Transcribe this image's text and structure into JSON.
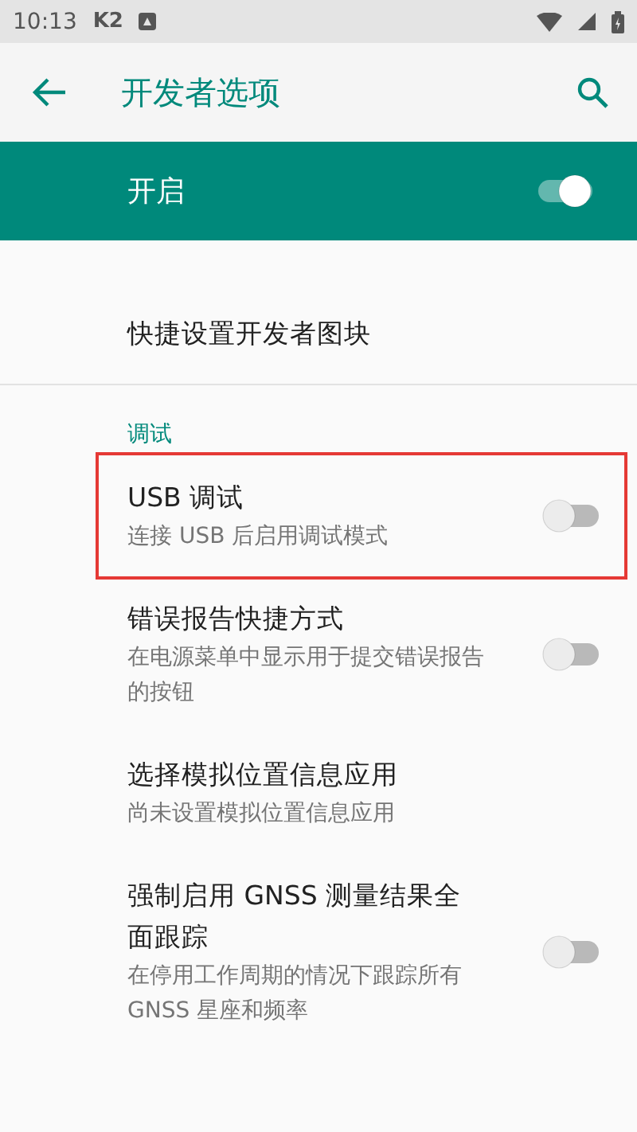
{
  "status_bar": {
    "time": "10:13",
    "carrier": "K2"
  },
  "app_bar": {
    "title": "开发者选项"
  },
  "master_switch": {
    "label": "开启",
    "on": true
  },
  "items": [
    {
      "kind": "plain",
      "title": "快捷设置开发者图块",
      "divider_after": true
    },
    {
      "kind": "category",
      "title": "调试"
    },
    {
      "kind": "switch",
      "title": "USB 调试",
      "summary": "连接 USB 后启用调试模式",
      "on": false,
      "highlighted": true
    },
    {
      "kind": "switch",
      "title": "错误报告快捷方式",
      "summary": "在电源菜单中显示用于提交错误报告的按钮",
      "on": false,
      "highlighted": false
    },
    {
      "kind": "plain",
      "title": "选择模拟位置信息应用",
      "summary": "尚未设置模拟位置信息应用"
    },
    {
      "kind": "switch",
      "title": "强制启用 GNSS 测量结果全面跟踪",
      "summary": "在停用工作周期的情况下跟踪所有 GNSS 星座和频率",
      "on": false,
      "highlighted": false
    }
  ]
}
